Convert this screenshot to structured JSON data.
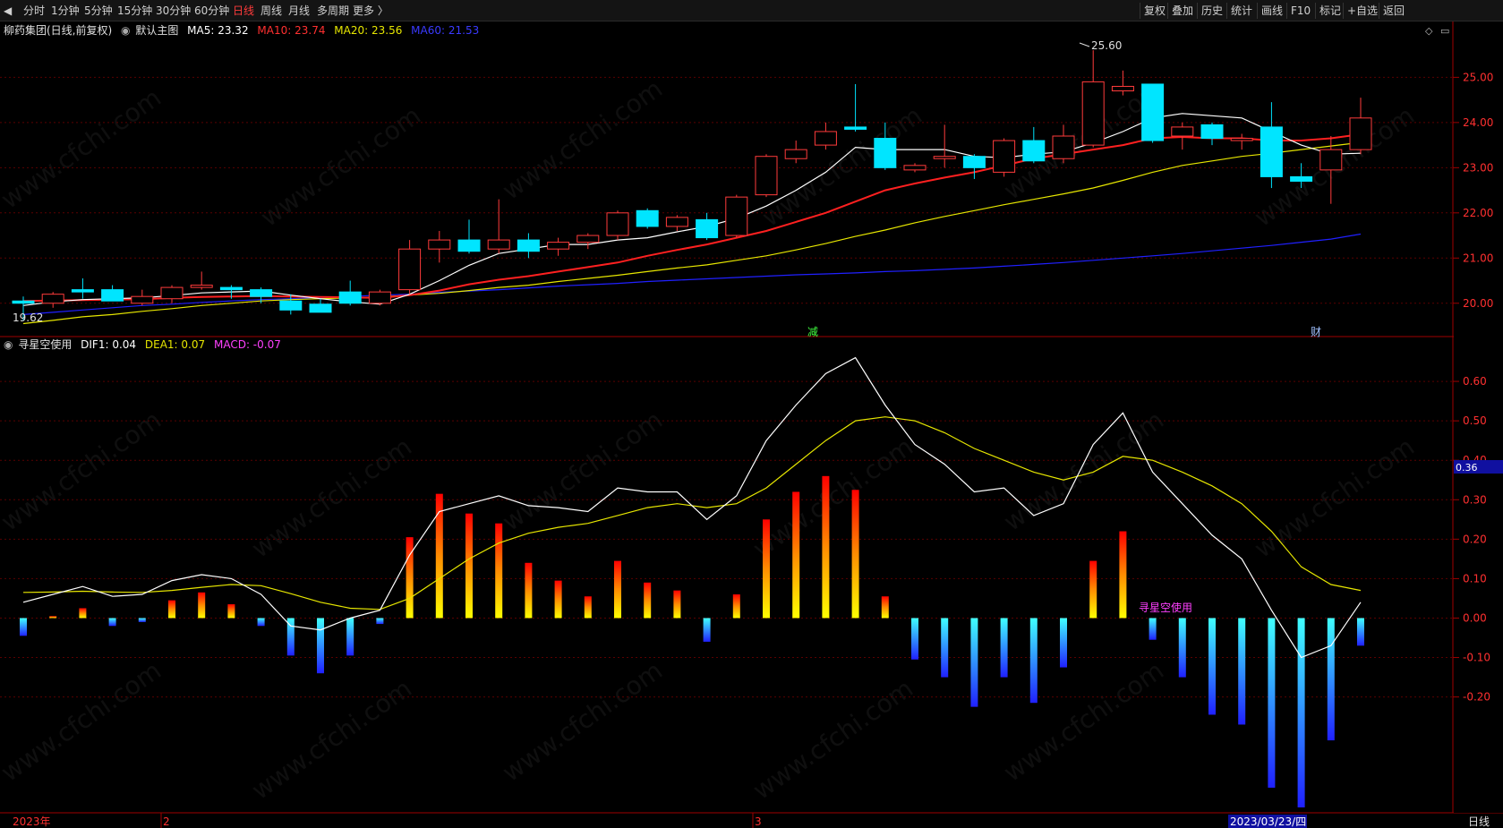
{
  "toolbar": {
    "periods": [
      "分时",
      "1分钟",
      "5分钟",
      "15分钟",
      "30分钟",
      "60分钟",
      "日线",
      "周线",
      "月线",
      "多周期",
      "更多 〉"
    ],
    "active_period": "日线",
    "right_buttons": [
      "复权",
      "叠加",
      "历史",
      "统计",
      "画线",
      "F10",
      "标记",
      "+自选",
      "返回"
    ]
  },
  "main_legend": {
    "stock": "柳药集团(日线,前复权)",
    "template": "默认主图",
    "ma5": "MA5: 23.32",
    "ma10": "MA10: 23.74",
    "ma20": "MA20: 23.56",
    "ma60": "MA60: 21.53"
  },
  "sub_legend": {
    "name": "寻星空使用",
    "dif": "DIF1: 0.04",
    "dea": "DEA1: 0.07",
    "macd": "MACD: -0.07"
  },
  "annotations": {
    "high_label": "25.60",
    "low_label": "19.62",
    "mark_a": "减",
    "mark_b": "财",
    "indicator_label": "寻星空使用",
    "price_marker": "0.36"
  },
  "bottom_axis": {
    "labels": [
      "2023年",
      "2",
      "3"
    ],
    "cursor_date": "2023/03/23/四",
    "period_label": "日线"
  },
  "colors": {
    "up": "#ff3b3b",
    "down": "#00e5ff",
    "ma5": "#ffffff",
    "ma10": "#ff2020",
    "ma20": "#e6e600",
    "ma60": "#2020ff",
    "macd_label": "#ff40ff",
    "grid": "#5a0000"
  },
  "chart_data": [
    {
      "type": "candlestick",
      "title": "柳药集团(日线,前复权)",
      "ylim": [
        19.5,
        25.8
      ],
      "yticks": [
        20.0,
        21.0,
        22.0,
        23.0,
        24.0,
        25.0
      ],
      "candles": [
        {
          "o": 20.05,
          "h": 20.15,
          "l": 19.62,
          "c": 20.0
        },
        {
          "o": 20.0,
          "h": 20.25,
          "l": 19.9,
          "c": 20.2
        },
        {
          "o": 20.3,
          "h": 20.55,
          "l": 20.1,
          "c": 20.25
        },
        {
          "o": 20.3,
          "h": 20.4,
          "l": 20.05,
          "c": 20.05
        },
        {
          "o": 20.0,
          "h": 20.3,
          "l": 19.95,
          "c": 20.15
        },
        {
          "o": 20.1,
          "h": 20.4,
          "l": 20.0,
          "c": 20.35
        },
        {
          "o": 20.35,
          "h": 20.7,
          "l": 20.3,
          "c": 20.4
        },
        {
          "o": 20.35,
          "h": 20.4,
          "l": 20.1,
          "c": 20.3
        },
        {
          "o": 20.3,
          "h": 20.35,
          "l": 20.0,
          "c": 20.15
        },
        {
          "o": 20.05,
          "h": 20.2,
          "l": 19.75,
          "c": 19.85
        },
        {
          "o": 19.98,
          "h": 20.1,
          "l": 19.8,
          "c": 19.8
        },
        {
          "o": 20.25,
          "h": 20.5,
          "l": 19.95,
          "c": 20.0
        },
        {
          "o": 20.0,
          "h": 20.3,
          "l": 19.95,
          "c": 20.25
        },
        {
          "o": 20.3,
          "h": 21.4,
          "l": 20.2,
          "c": 21.2
        },
        {
          "o": 21.2,
          "h": 21.6,
          "l": 20.9,
          "c": 21.4
        },
        {
          "o": 21.4,
          "h": 21.85,
          "l": 21.1,
          "c": 21.15
        },
        {
          "o": 21.2,
          "h": 22.3,
          "l": 21.1,
          "c": 21.4
        },
        {
          "o": 21.4,
          "h": 21.55,
          "l": 21.0,
          "c": 21.15
        },
        {
          "o": 21.2,
          "h": 21.45,
          "l": 21.05,
          "c": 21.35
        },
        {
          "o": 21.35,
          "h": 21.55,
          "l": 21.2,
          "c": 21.5
        },
        {
          "o": 21.5,
          "h": 22.05,
          "l": 21.4,
          "c": 22.0
        },
        {
          "o": 22.05,
          "h": 22.1,
          "l": 21.65,
          "c": 21.7
        },
        {
          "o": 21.7,
          "h": 21.95,
          "l": 21.6,
          "c": 21.9
        },
        {
          "o": 21.85,
          "h": 22.0,
          "l": 21.4,
          "c": 21.45
        },
        {
          "o": 21.5,
          "h": 22.4,
          "l": 21.45,
          "c": 22.35
        },
        {
          "o": 22.4,
          "h": 23.3,
          "l": 22.35,
          "c": 23.25
        },
        {
          "o": 23.2,
          "h": 23.6,
          "l": 23.1,
          "c": 23.4
        },
        {
          "o": 23.5,
          "h": 24.0,
          "l": 23.4,
          "c": 23.8
        },
        {
          "o": 23.9,
          "h": 24.85,
          "l": 23.8,
          "c": 23.85
        },
        {
          "o": 23.65,
          "h": 24.0,
          "l": 22.95,
          "c": 23.0
        },
        {
          "o": 22.95,
          "h": 23.1,
          "l": 22.9,
          "c": 23.05
        },
        {
          "o": 23.2,
          "h": 23.95,
          "l": 23.0,
          "c": 23.25
        },
        {
          "o": 23.25,
          "h": 23.3,
          "l": 22.75,
          "c": 23.0
        },
        {
          "o": 22.9,
          "h": 23.65,
          "l": 22.8,
          "c": 23.6
        },
        {
          "o": 23.6,
          "h": 23.9,
          "l": 23.1,
          "c": 23.15
        },
        {
          "o": 23.2,
          "h": 23.95,
          "l": 23.1,
          "c": 23.7
        },
        {
          "o": 23.5,
          "h": 25.6,
          "l": 23.45,
          "c": 24.9
        },
        {
          "o": 24.7,
          "h": 25.15,
          "l": 24.6,
          "c": 24.8
        },
        {
          "o": 24.85,
          "h": 24.85,
          "l": 23.55,
          "c": 23.6
        },
        {
          "o": 23.7,
          "h": 24.0,
          "l": 23.4,
          "c": 23.9
        },
        {
          "o": 23.95,
          "h": 24.0,
          "l": 23.5,
          "c": 23.65
        },
        {
          "o": 23.6,
          "h": 23.75,
          "l": 23.4,
          "c": 23.65
        },
        {
          "o": 23.9,
          "h": 24.45,
          "l": 22.55,
          "c": 22.8
        },
        {
          "o": 22.8,
          "h": 23.1,
          "l": 22.55,
          "c": 22.7
        },
        {
          "o": 22.95,
          "h": 23.7,
          "l": 22.2,
          "c": 23.4
        },
        {
          "o": 23.4,
          "h": 24.55,
          "l": 23.3,
          "c": 24.1
        }
      ],
      "ma5": [
        19.95,
        20.03,
        20.08,
        20.1,
        20.12,
        20.17,
        20.23,
        20.25,
        20.27,
        20.18,
        20.1,
        20.03,
        19.98,
        20.2,
        20.5,
        20.84,
        21.1,
        21.2,
        21.3,
        21.3,
        21.4,
        21.45,
        21.58,
        21.7,
        21.88,
        22.15,
        22.5,
        22.9,
        23.45,
        23.4,
        23.4,
        23.4,
        23.25,
        23.22,
        23.3,
        23.35,
        23.55,
        23.8,
        24.1,
        24.2,
        24.15,
        24.1,
        23.8,
        23.5,
        23.3,
        23.32
      ],
      "ma10": [
        20.05,
        20.06,
        20.07,
        20.08,
        20.09,
        20.12,
        20.14,
        20.15,
        20.16,
        20.15,
        20.14,
        20.13,
        20.12,
        20.18,
        20.28,
        20.42,
        20.52,
        20.6,
        20.7,
        20.8,
        20.9,
        21.05,
        21.18,
        21.3,
        21.45,
        21.6,
        21.8,
        22.0,
        22.25,
        22.5,
        22.65,
        22.78,
        22.9,
        23.05,
        23.2,
        23.3,
        23.4,
        23.5,
        23.65,
        23.68,
        23.65,
        23.65,
        23.6,
        23.6,
        23.65,
        23.74
      ],
      "ma20": [
        19.55,
        19.62,
        19.7,
        19.75,
        19.82,
        19.88,
        19.95,
        20.0,
        20.05,
        20.08,
        20.1,
        20.12,
        20.14,
        20.18,
        20.22,
        20.28,
        20.35,
        20.4,
        20.48,
        20.55,
        20.62,
        20.7,
        20.78,
        20.85,
        20.95,
        21.05,
        21.18,
        21.32,
        21.48,
        21.62,
        21.78,
        21.92,
        22.05,
        22.18,
        22.3,
        22.42,
        22.55,
        22.72,
        22.9,
        23.05,
        23.15,
        23.25,
        23.32,
        23.4,
        23.48,
        23.56
      ],
      "ma60": [
        19.75,
        19.8,
        19.85,
        19.9,
        19.95,
        19.98,
        20.02,
        20.05,
        20.08,
        20.1,
        20.13,
        20.15,
        20.18,
        20.2,
        20.24,
        20.27,
        20.3,
        20.34,
        20.38,
        20.41,
        20.44,
        20.48,
        20.51,
        20.54,
        20.57,
        20.6,
        20.63,
        20.65,
        20.67,
        20.7,
        20.72,
        20.75,
        20.78,
        20.82,
        20.86,
        20.9,
        20.95,
        21.0,
        21.05,
        21.1,
        21.16,
        21.22,
        21.28,
        21.35,
        21.42,
        21.53
      ]
    },
    {
      "type": "bar",
      "title": "寻星空使用",
      "ylim": [
        -0.48,
        0.7
      ],
      "yticks": [
        -0.2,
        -0.1,
        0.0,
        0.1,
        0.2,
        0.3,
        0.4,
        0.5,
        0.6
      ],
      "dif": [
        0.04,
        0.06,
        0.08,
        0.055,
        0.06,
        0.095,
        0.11,
        0.1,
        0.06,
        -0.02,
        -0.03,
        0.0,
        0.02,
        0.16,
        0.27,
        0.29,
        0.31,
        0.285,
        0.28,
        0.27,
        0.33,
        0.32,
        0.32,
        0.25,
        0.31,
        0.45,
        0.54,
        0.62,
        0.66,
        0.54,
        0.44,
        0.39,
        0.32,
        0.33,
        0.26,
        0.29,
        0.44,
        0.52,
        0.37,
        0.29,
        0.21,
        0.15,
        0.02,
        -0.1,
        -0.07,
        0.04
      ],
      "dea": [
        0.065,
        0.066,
        0.068,
        0.066,
        0.065,
        0.07,
        0.078,
        0.085,
        0.082,
        0.062,
        0.04,
        0.025,
        0.022,
        0.05,
        0.1,
        0.15,
        0.19,
        0.215,
        0.23,
        0.24,
        0.26,
        0.28,
        0.29,
        0.28,
        0.29,
        0.33,
        0.39,
        0.45,
        0.5,
        0.51,
        0.5,
        0.47,
        0.43,
        0.4,
        0.37,
        0.35,
        0.37,
        0.41,
        0.4,
        0.37,
        0.335,
        0.29,
        0.22,
        0.13,
        0.085,
        0.07
      ],
      "macd": [
        -0.045,
        0.005,
        0.025,
        -0.02,
        -0.01,
        0.045,
        0.065,
        0.035,
        -0.02,
        -0.095,
        -0.14,
        -0.095,
        -0.015,
        0.205,
        0.315,
        0.265,
        0.24,
        0.14,
        0.095,
        0.055,
        0.145,
        0.09,
        0.07,
        -0.06,
        0.06,
        0.25,
        0.32,
        0.36,
        0.325,
        0.055,
        -0.105,
        -0.15,
        -0.225,
        -0.15,
        -0.215,
        -0.125,
        0.145,
        0.22,
        -0.055,
        -0.15,
        -0.245,
        -0.27,
        -0.43,
        -0.48,
        -0.31,
        -0.07
      ]
    }
  ]
}
